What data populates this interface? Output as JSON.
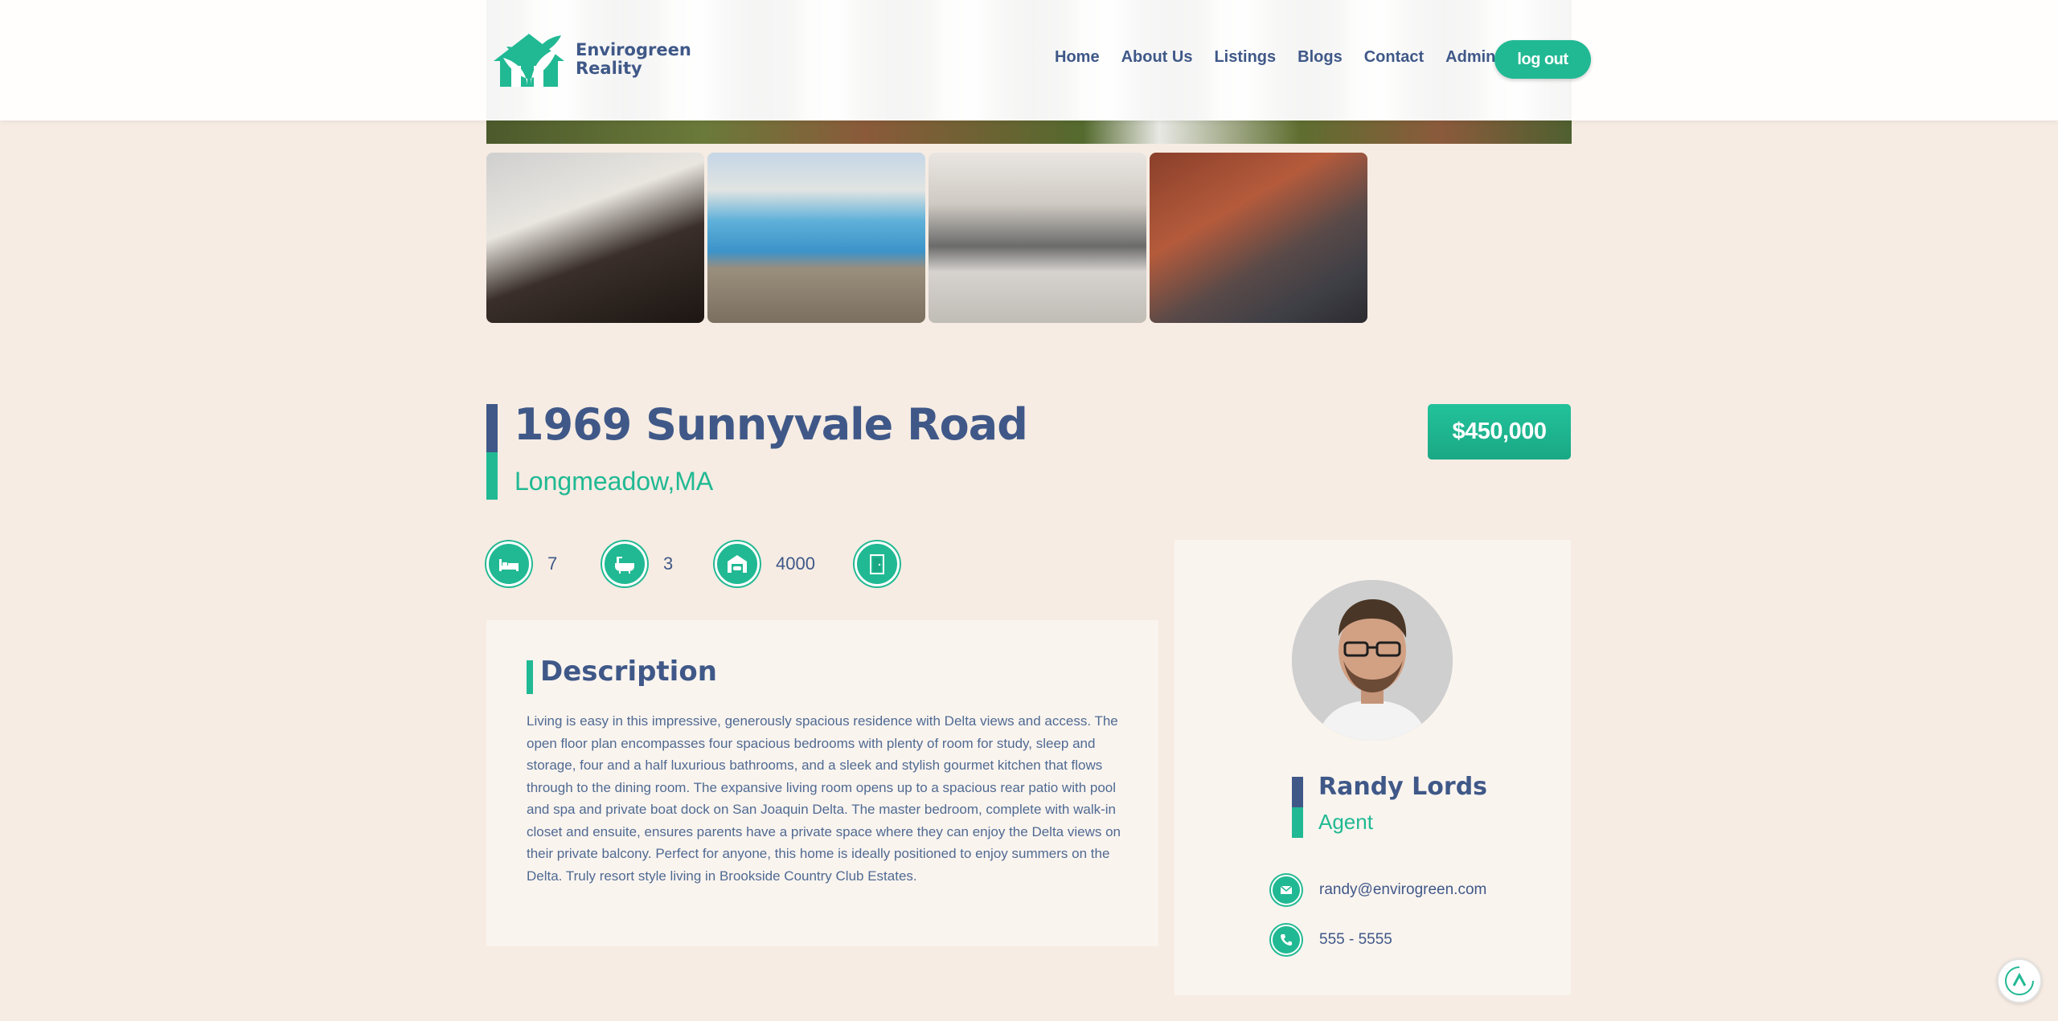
{
  "header": {
    "logo_line1": "Envirogreen",
    "logo_line2": "Reality",
    "nav": [
      "Home",
      "About Us",
      "Listings",
      "Blogs",
      "Contact",
      "Admin"
    ],
    "logout_label": "log out"
  },
  "gallery": {
    "thumbnails": [
      "dining-room-photo",
      "pool-photo",
      "kitchen-photo",
      "living-room-photo"
    ]
  },
  "listing": {
    "address": "1969 Sunnyvale Road",
    "city": "Longmeadow,MA",
    "price": "$450,000",
    "features": [
      {
        "icon": "bed-icon",
        "value": "7"
      },
      {
        "icon": "bathtub-icon",
        "value": "3"
      },
      {
        "icon": "garage-icon",
        "value": "4000"
      },
      {
        "icon": "door-icon",
        "value": ""
      }
    ]
  },
  "description": {
    "heading": "Description",
    "body": "Living is easy in this impressive, generously spacious residence with Delta views and access. The open floor plan encompasses four spacious bedrooms with plenty of room for study, sleep and storage, four and a half luxurious bathrooms, and a sleek and stylish gourmet kitchen that flows through to the dining room. The expansive living room opens up to a spacious rear patio with pool and spa and private boat dock on San Joaquin Delta. The master bedroom, complete with walk-in closet and ensuite, ensures parents have a private space where they can enjoy the Delta views on their private balcony. Perfect for anyone, this home is ideally positioned to enjoy summers on the Delta. Truly resort style living in Brookside Country Club Estates."
  },
  "agent": {
    "name": "Randy Lords",
    "role": "Agent",
    "email": "randy@envirogreen.com",
    "phone": "555 - 5555"
  },
  "colors": {
    "brand_green": "#21b993",
    "brand_navy": "#3f5888",
    "background": "#f6ece3"
  }
}
